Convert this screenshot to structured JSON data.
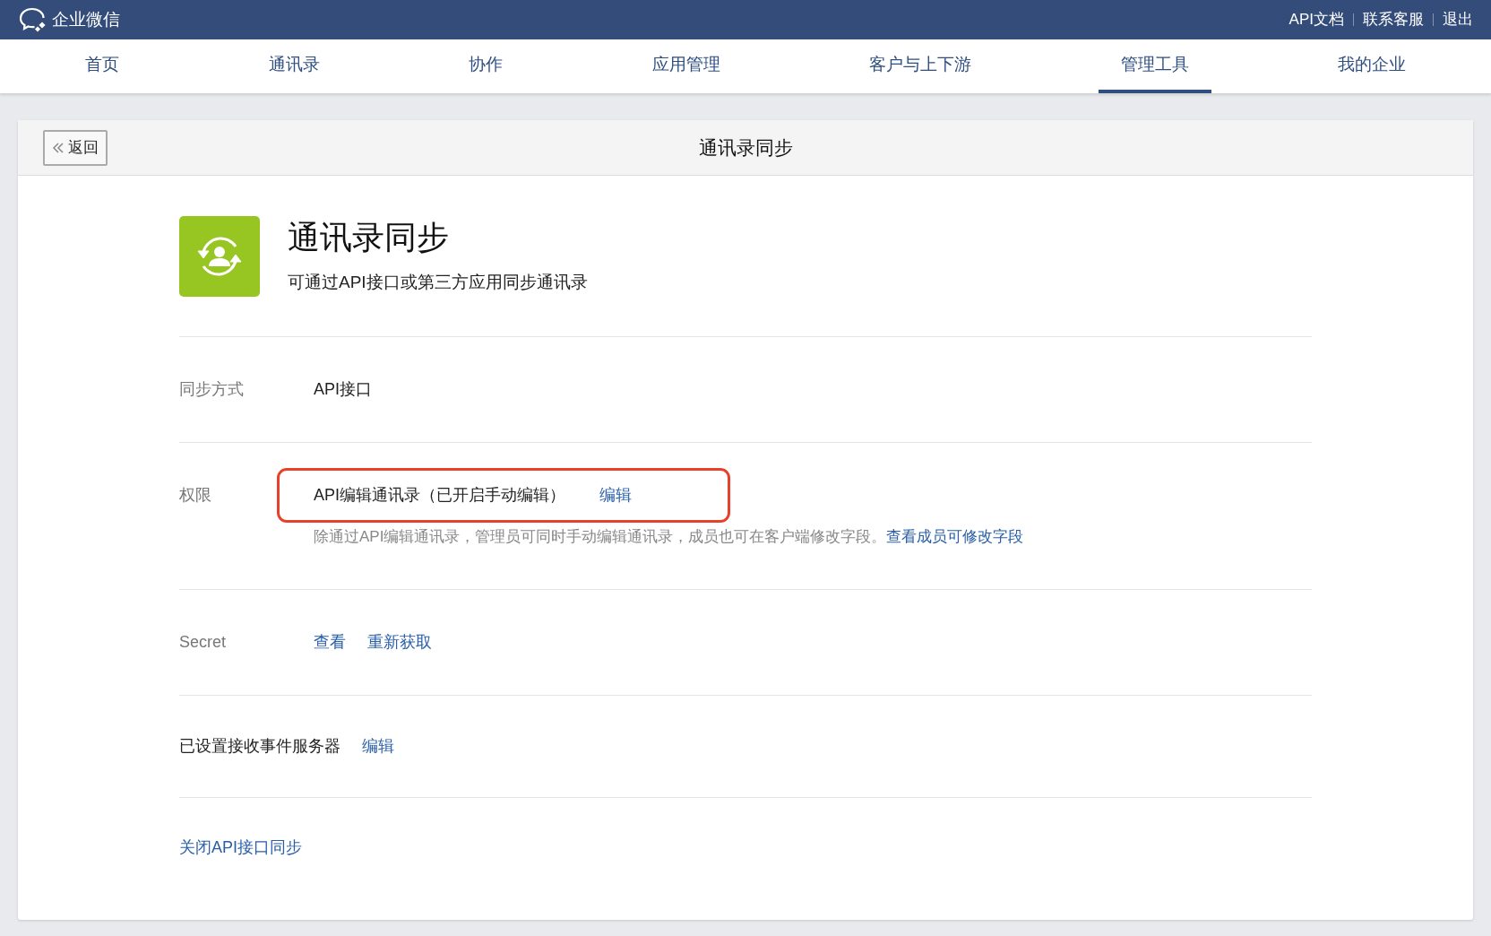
{
  "top_bar": {
    "logo_text": "企业微信",
    "links": [
      "API文档",
      "联系客服",
      "退出"
    ]
  },
  "nav_tabs": [
    {
      "label": "首页",
      "selected": false
    },
    {
      "label": "通讯录",
      "selected": false
    },
    {
      "label": "协作",
      "selected": false
    },
    {
      "label": "应用管理",
      "selected": false
    },
    {
      "label": "客户与上下游",
      "selected": false
    },
    {
      "label": "管理工具",
      "selected": true
    },
    {
      "label": "我的企业",
      "selected": false
    }
  ],
  "card_header": {
    "back_button": "返回",
    "title": "通讯录同步"
  },
  "app_info": {
    "title": "通讯录同步",
    "description": "可通过API接口或第三方应用同步通讯录"
  },
  "rows": [
    {
      "kind": "value",
      "label": "同步方式",
      "value": "API接口",
      "highlighted": false
    },
    {
      "kind": "permission",
      "label": "权限",
      "value": "API编辑通讯录（已开启手动编辑）",
      "links": [
        "编辑"
      ],
      "note": "除通过API编辑通讯录，管理员可同时手动编辑通讯录，成员也可在客户端修改字段。",
      "note_link": "查看成员可修改字段",
      "highlighted": true
    },
    {
      "kind": "links",
      "label": "Secret",
      "links": [
        "查看",
        "重新获取"
      ],
      "highlighted": false
    },
    {
      "kind": "inline",
      "label": "已设置接收事件服务器",
      "links": [
        "编辑"
      ],
      "highlighted": false
    }
  ],
  "footer_link": "关闭API接口同步"
}
